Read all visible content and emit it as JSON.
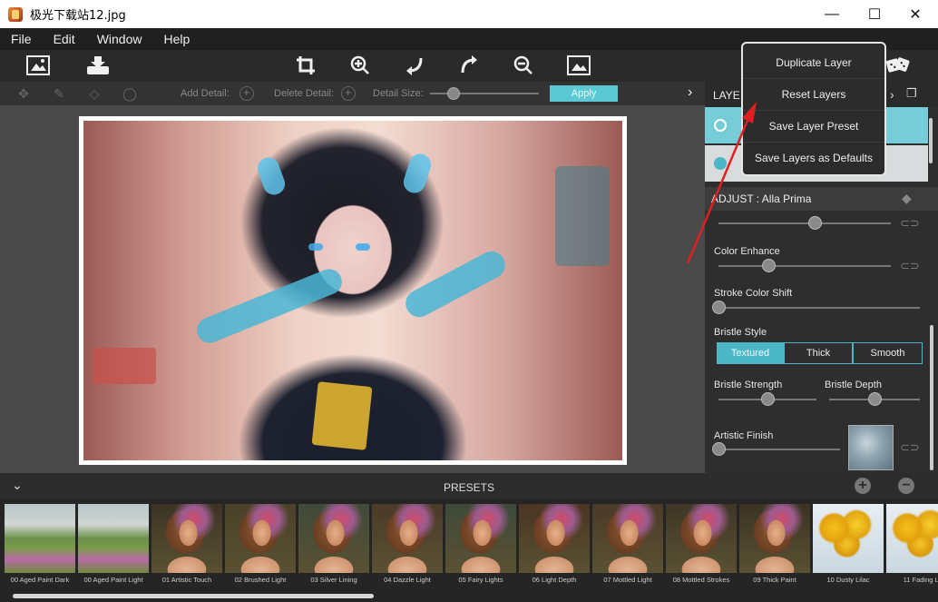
{
  "window": {
    "title": "极光下载站12.jpg",
    "minimize": "—",
    "maximize": "☐",
    "close": "✕"
  },
  "menu": [
    "File",
    "Edit",
    "Window",
    "Help"
  ],
  "toolbar": {
    "icons": [
      "open-image-icon",
      "save-icon",
      "crop-icon",
      "zoom-in-icon",
      "undo-icon",
      "redo-icon",
      "zoom-out-icon",
      "preview-icon",
      "randomize-icon"
    ]
  },
  "detail_bar": {
    "add_detail": "Add Detail:",
    "delete_detail": "Delete Detail:",
    "detail_size": "Detail Size:",
    "apply": "Apply",
    "detail_size_level": 0.22
  },
  "layers": {
    "title": "LAYE"
  },
  "context_menu": {
    "items": [
      "Duplicate Layer",
      "Reset Layers",
      "Save Layer Preset",
      "Save Layers as Defaults"
    ]
  },
  "adjust": {
    "title": "ADJUST : Alla Prima",
    "sliders": {
      "top_level": 0.56,
      "color_enhance_label": "Color Enhance",
      "color_enhance_level": 0.29,
      "stroke_color_shift_label": "Stroke Color Shift",
      "stroke_color_shift_level": 0.0,
      "bristle_strength_label": "Bristle Strength",
      "bristle_strength_level": 0.5,
      "bristle_depth_label": "Bristle Depth",
      "bristle_depth_level": 0.5,
      "artistic_finish_label": "Artistic Finish",
      "artistic_finish_level": 0.0
    },
    "bristle_style": {
      "label": "Bristle Style",
      "options": [
        "Textured",
        "Thick",
        "Smooth"
      ],
      "selected": "Textured"
    }
  },
  "presets": {
    "title": "PRESETS",
    "add": "+",
    "remove": "−",
    "items": [
      {
        "caption": "00 Aged Paint Dark",
        "kind": "landscape"
      },
      {
        "caption": "00 Aged Paint Light",
        "kind": "landscape"
      },
      {
        "caption": "01 Artistic Touch",
        "kind": "portrait"
      },
      {
        "caption": "02 Brushed Light",
        "kind": "portrait"
      },
      {
        "caption": "03 Silver Lining",
        "kind": "portrait"
      },
      {
        "caption": "04 Dazzle Light",
        "kind": "portrait"
      },
      {
        "caption": "05 Fairy Lights",
        "kind": "portrait"
      },
      {
        "caption": "06 Light Depth",
        "kind": "portrait"
      },
      {
        "caption": "07 Mottled Light",
        "kind": "portrait"
      },
      {
        "caption": "08 Mottled Strokes",
        "kind": "portrait"
      },
      {
        "caption": "09 Thick Paint",
        "kind": "portrait"
      },
      {
        "caption": "10 Dusty Lilac",
        "kind": "flowers"
      },
      {
        "caption": "11 Fading Li",
        "kind": "flowers"
      }
    ]
  },
  "colors": {
    "accent": "#4cb7c7",
    "layer_selected": "#76cdd8",
    "panel": "#2e2e2e"
  }
}
